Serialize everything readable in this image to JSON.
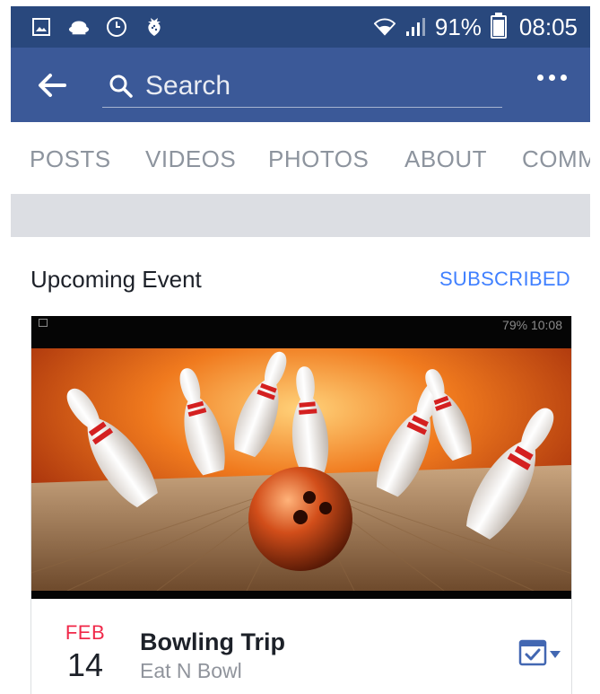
{
  "status_bar": {
    "battery_percent": "91%",
    "battery_level": 0.91,
    "time": "08:05",
    "left_icons": [
      "image-icon",
      "cloud-icon",
      "clock-icon",
      "strawberry-icon"
    ],
    "right_icons": [
      "wifi-icon",
      "signal-icon",
      "battery-icon"
    ]
  },
  "app_bar": {
    "search_placeholder": "Search",
    "icons": [
      "back-arrow-icon",
      "search-icon",
      "more-options-icon"
    ],
    "color": "#3b5998"
  },
  "tabs": [
    {
      "label": "POSTS"
    },
    {
      "label": "VIDEOS"
    },
    {
      "label": "PHOTOS"
    },
    {
      "label": "ABOUT"
    },
    {
      "label": "COMM"
    }
  ],
  "section": {
    "title": "Upcoming Event",
    "action": "SUBSCRIBED"
  },
  "event": {
    "image_status": "79%  10:08",
    "month": "FEB",
    "day": "14",
    "title": "Bowling Trip",
    "place": "Eat N Bowl",
    "action_icon": "calendar-check-icon"
  },
  "colors": {
    "facebook_blue": "#3b5998",
    "status_bar": "#29487d",
    "link_blue": "#4080ff",
    "month_red": "#f02849"
  }
}
